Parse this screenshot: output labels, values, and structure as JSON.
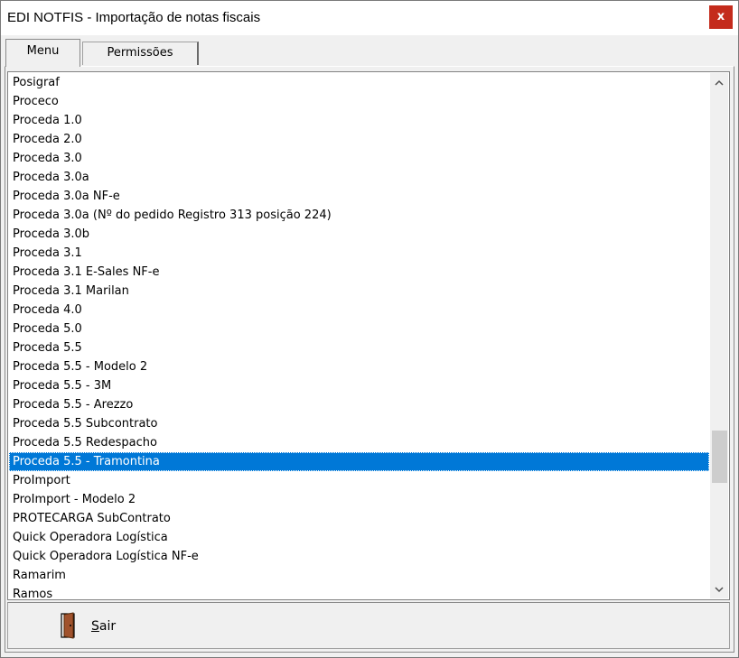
{
  "window": {
    "title": "EDI NOTFIS - Importação de notas fiscais",
    "close_glyph": "x"
  },
  "tabs": [
    {
      "label": "Menu",
      "active": true
    },
    {
      "label": "Permissões",
      "active": false
    }
  ],
  "list": {
    "items": [
      "Posigraf",
      "Proceco",
      "Proceda 1.0",
      "Proceda 2.0",
      "Proceda 3.0",
      "Proceda 3.0a",
      "Proceda 3.0a NF-e",
      "Proceda 3.0a (Nº do pedido Registro 313 posição 224)",
      "Proceda 3.0b",
      "Proceda 3.1",
      "Proceda 3.1 E-Sales NF-e",
      "Proceda 3.1 Marilan",
      "Proceda 4.0",
      "Proceda 5.0",
      "Proceda 5.5",
      "Proceda 5.5 - Modelo 2",
      "Proceda 5.5 - 3M",
      "Proceda 5.5 - Arezzo",
      "Proceda 5.5 Subcontrato",
      "Proceda 5.5 Redespacho",
      "Proceda 5.5 - Tramontina",
      "ProImport",
      "ProImport - Modelo 2",
      "PROTECARGA SubContrato",
      "Quick Operadora Logística",
      "Quick Operadora Logística NF-e",
      "Ramarim",
      "Ramos"
    ],
    "selected_index": 20
  },
  "scrollbar": {
    "up_icon": "chevron-up-icon",
    "down_icon": "chevron-down-icon"
  },
  "footer": {
    "exit_button": {
      "mnemonic": "S",
      "rest": "air",
      "icon": "door-exit-icon"
    }
  },
  "colors": {
    "selection": "#0078d7",
    "close_button": "#c42b1c",
    "door": "#a0522d"
  }
}
